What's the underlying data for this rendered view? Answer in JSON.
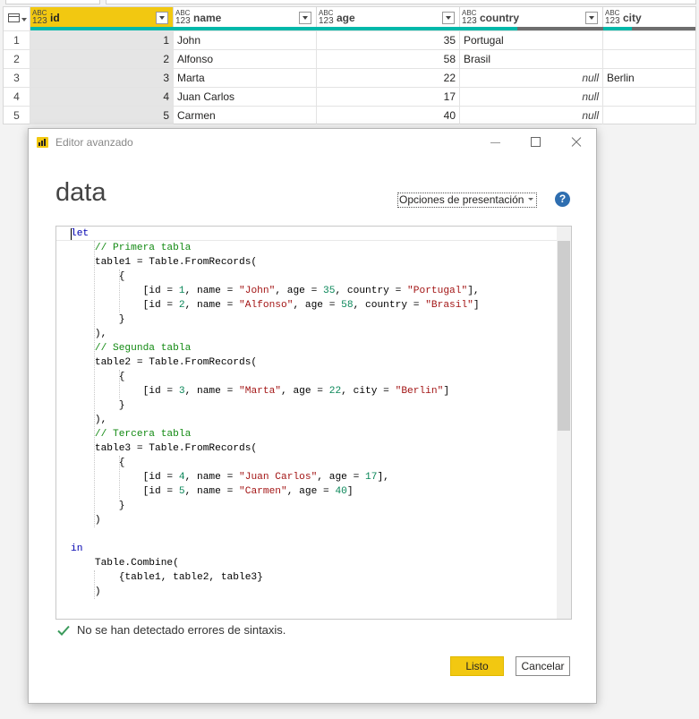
{
  "grid": {
    "columns": [
      {
        "name": "id",
        "type_top": "ABC",
        "type_bottom": "123"
      },
      {
        "name": "name",
        "type_top": "ABC",
        "type_bottom": "123"
      },
      {
        "name": "age",
        "type_top": "ABC",
        "type_bottom": "123"
      },
      {
        "name": "country",
        "type_top": "ABC",
        "type_bottom": "123"
      },
      {
        "name": "city",
        "type_top": "ABC",
        "type_bottom": "123"
      }
    ],
    "rows": [
      {
        "n": "1",
        "id": "1",
        "name": "John",
        "age": "35",
        "country": "Portugal",
        "city": ""
      },
      {
        "n": "2",
        "id": "2",
        "name": "Alfonso",
        "age": "58",
        "country": "Brasil",
        "city": ""
      },
      {
        "n": "3",
        "id": "3",
        "name": "Marta",
        "age": "22",
        "country": "null",
        "city": "Berlin"
      },
      {
        "n": "4",
        "id": "4",
        "name": "Juan Carlos",
        "age": "17",
        "country": "null",
        "city": ""
      },
      {
        "n": "5",
        "id": "5",
        "name": "Carmen",
        "age": "40",
        "country": "null",
        "city": ""
      }
    ],
    "colors": {
      "selected_header": "#f2c811",
      "quality_valid": "#01b8aa",
      "quality_empty": "#6e6e6e"
    }
  },
  "dialog": {
    "window_title": "Editor avanzado",
    "query_name": "data",
    "display_options_label": "Opciones de presentación",
    "help_symbol": "?",
    "code_lines": [
      "let",
      "    // Primera tabla",
      "    table1 = Table.FromRecords(",
      "        {",
      "            [id = 1, name = \"John\", age = 35, country = \"Portugal\"],",
      "            [id = 2, name = \"Alfonso\", age = 58, country = \"Brasil\"]",
      "        }",
      "    ),",
      "    // Segunda tabla",
      "    table2 = Table.FromRecords(",
      "        {",
      "            [id = 3, name = \"Marta\", age = 22, city = \"Berlin\"]",
      "        }",
      "    ),",
      "    // Tercera tabla",
      "    table3 = Table.FromRecords(",
      "        {",
      "            [id = 4, name = \"Juan Carlos\", age = 17],",
      "            [id = 5, name = \"Carmen\", age = 40]",
      "        }",
      "    )",
      "",
      "in",
      "    Table.Combine(",
      "        {table1, table2, table3}",
      "    )"
    ],
    "status_text": "No se han detectado errores de sintaxis.",
    "ok_label": "Listo",
    "cancel_label": "Cancelar",
    "colors": {
      "accent": "#f2c811",
      "help": "#2e6eb0",
      "check": "#3a9a5b",
      "keyword": "#0000b0",
      "comment": "#138a13",
      "string": "#a31515",
      "number": "#098658"
    }
  }
}
